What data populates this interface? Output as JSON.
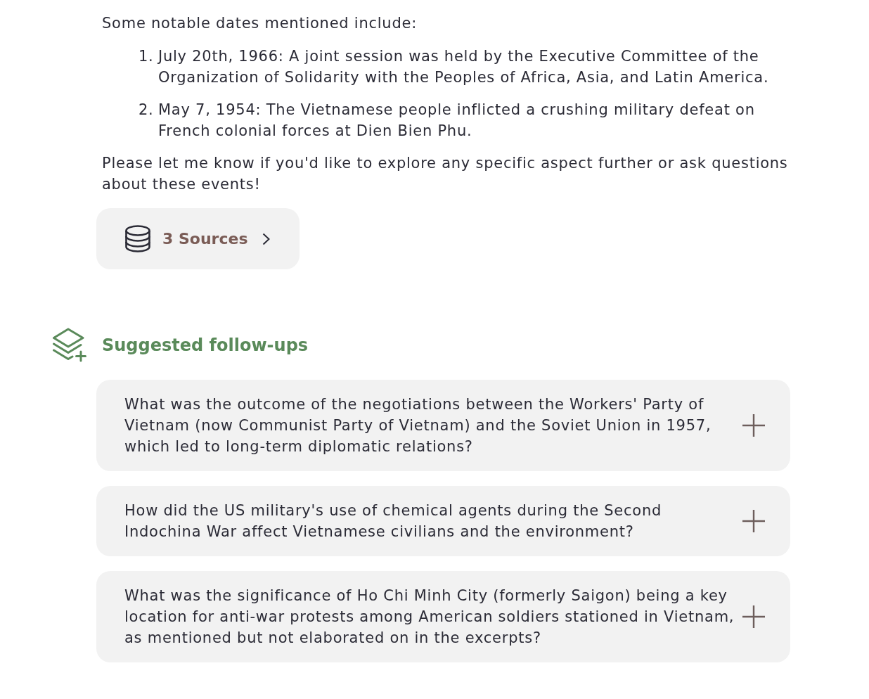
{
  "intro": "Some notable dates mentioned include:",
  "dates": [
    {
      "number": "1.",
      "text": "July 20th, 1966: A joint session was held by the Executive Committee of the Organization of Solidarity with the Peoples of Africa, Asia, and Latin America."
    },
    {
      "number": "2.",
      "text": "May 7, 1954: The Vietnamese people inflicted a crushing military defeat on French colonial forces at Dien Bien Phu."
    }
  ],
  "closing": "Please let me know if you'd like to explore any specific aspect further or ask questions about these events!",
  "sources_button": {
    "label": "3 Sources"
  },
  "follow_ups": {
    "title": "Suggested follow-ups",
    "items": [
      "What was the outcome of the negotiations between the Workers' Party of Vietnam (now Communist Party of Vietnam) and the Soviet Union in 1957, which led to long-term diplomatic relations?",
      "How did the US military's use of chemical agents during the Second Indochina War affect Vietnamese civilians and the environment?",
      "What was the significance of Ho Chi Minh City (formerly Saigon) being a key location for anti-war protests among American soldiers stationed in Vietnam, as mentioned but not elaborated on in the excerpts?"
    ]
  }
}
